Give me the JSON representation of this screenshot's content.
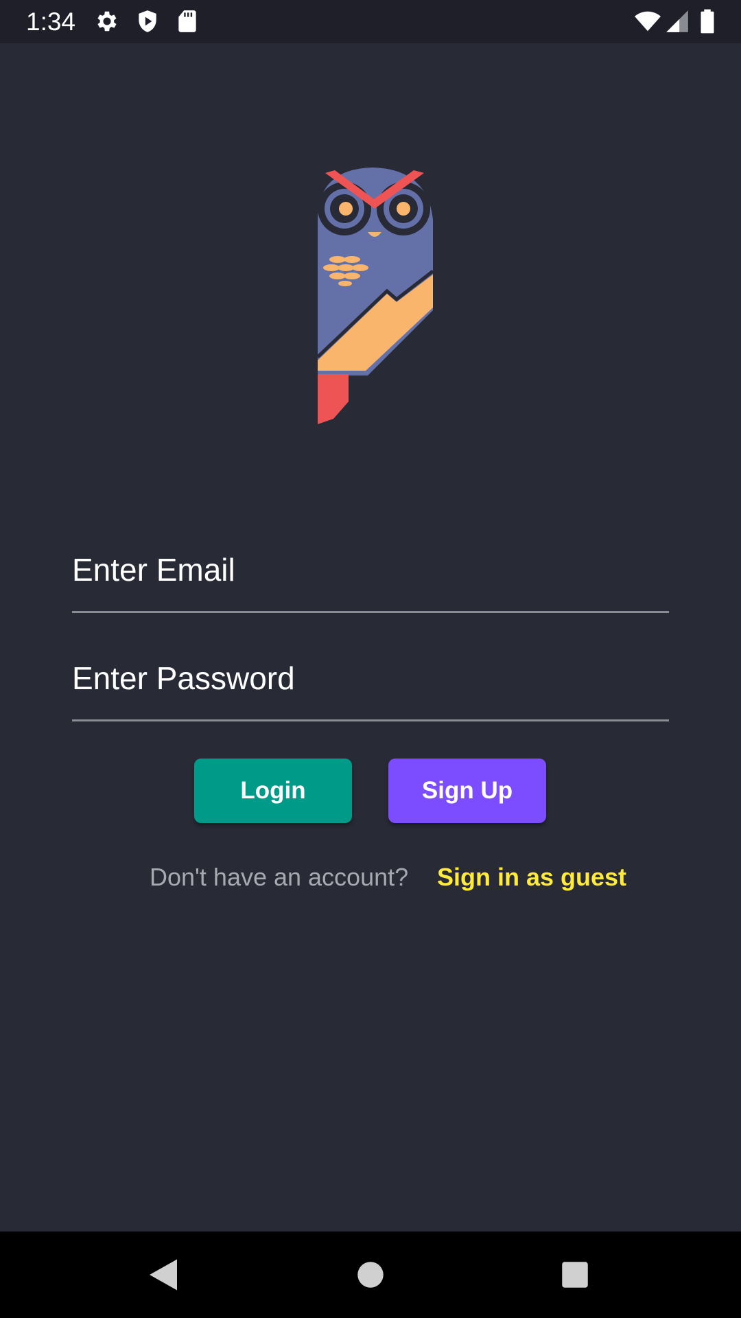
{
  "status_bar": {
    "time": "1:34",
    "left_icons": [
      "settings-gear-icon",
      "shield-play-icon",
      "sd-card-icon"
    ],
    "right_icons": [
      "wifi-icon",
      "cell-signal-icon",
      "battery-icon"
    ]
  },
  "logo": {
    "icon": "owl-logo-icon",
    "colors": {
      "body": "#6470a8",
      "belly": "#f9b56b",
      "brow": "#ee5454",
      "tail": "#ee5454",
      "eye_ring": "#282a36"
    }
  },
  "form": {
    "email_placeholder": "Enter Email",
    "password_placeholder": "Enter Password",
    "email_value": "",
    "password_value": ""
  },
  "buttons": {
    "login_label": "Login",
    "signup_label": "Sign Up"
  },
  "guest": {
    "prompt": "Don't have an account?",
    "link_label": "Sign in as guest"
  },
  "nav_bar": {
    "icons": [
      "back-triangle-icon",
      "home-circle-icon",
      "recents-square-icon"
    ]
  },
  "colors": {
    "background": "#282a36",
    "status_bar": "#1e1f29",
    "login_button": "#009a89",
    "signup_button": "#7c4dff",
    "guest_link": "#ffeb3b",
    "prompt_text": "#a7a9b0",
    "underline": "#8a8c94"
  }
}
